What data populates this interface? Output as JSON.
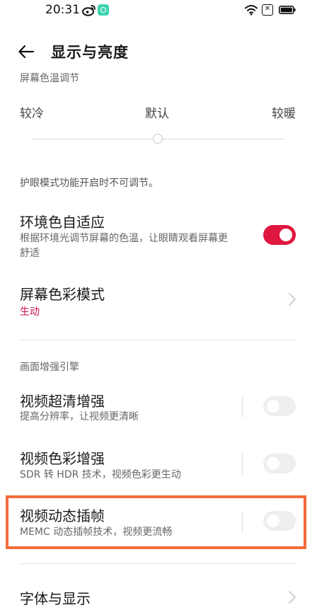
{
  "status_bar": {
    "time": "20:31",
    "sim_label": "✕"
  },
  "header": {
    "title": "显示与亮度"
  },
  "color_temperature": {
    "section_label": "屏幕色温调节",
    "labels": [
      "较冷",
      "默认",
      "较暖"
    ],
    "slider_value": 0.5
  },
  "eye_care_note": "护眼模式功能开启时不可调节。",
  "ambient_adapt": {
    "title": "环境色自适应",
    "subtitle_line1": "根据环境光调节屏幕的色温，让眼睛观看屏幕更",
    "subtitle_line2": "舒适",
    "enabled": true
  },
  "color_mode": {
    "title": "屏幕色彩模式",
    "value": "生动",
    "value_color": "#c4114a"
  },
  "enhance_engine": {
    "section_label": "画面增强引擎",
    "items": [
      {
        "title": "视频超清增强",
        "subtitle": "提高分辨率，让视频更清晰",
        "enabled": false
      },
      {
        "title": "视频色彩增强",
        "subtitle": "SDR 转 HDR 技术，视频色彩更生动",
        "enabled": false
      },
      {
        "title": "视频动态插帧",
        "subtitle": "MEMC 动态插帧技术，视频更流畅",
        "enabled": false
      }
    ]
  },
  "font_display": {
    "title": "字体与显示"
  },
  "colors": {
    "accent": "#e0173e",
    "highlight": "#f56b3b"
  }
}
